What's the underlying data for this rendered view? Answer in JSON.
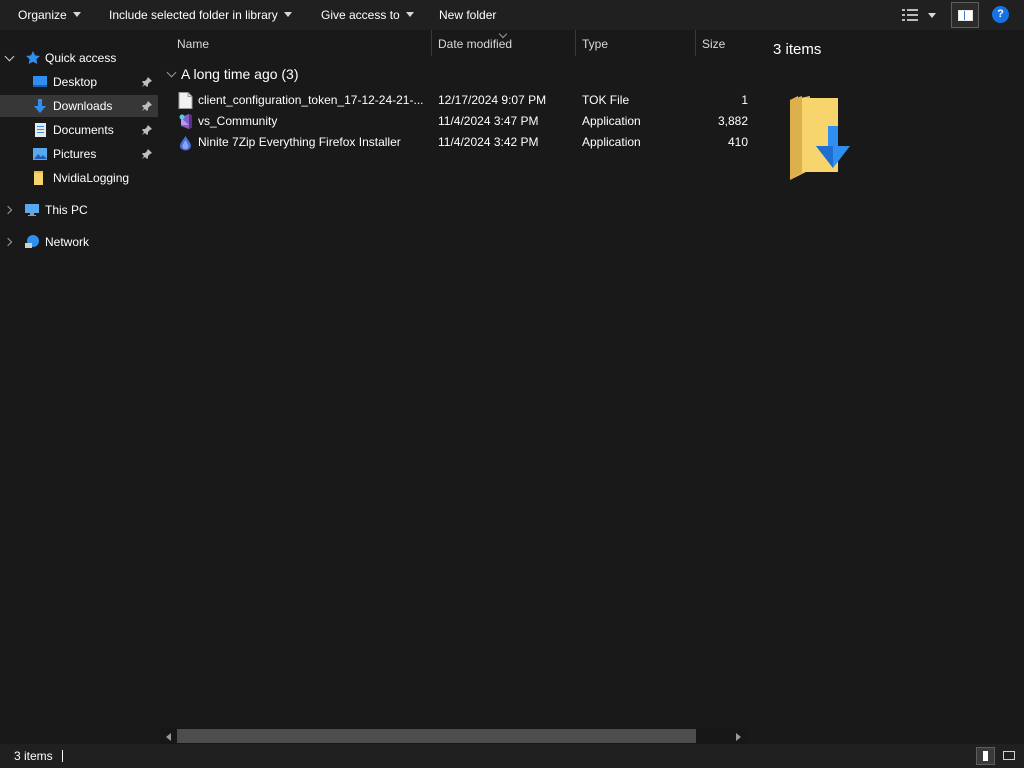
{
  "toolbar": {
    "organize": "Organize",
    "include_library": "Include selected folder in library",
    "give_access": "Give access to",
    "new_folder": "New folder"
  },
  "nav": {
    "quick_access": "Quick access",
    "items": [
      {
        "label": "Desktop",
        "icon": "desktop-icon",
        "pinned": true
      },
      {
        "label": "Downloads",
        "icon": "downloads-icon",
        "pinned": true,
        "selected": true
      },
      {
        "label": "Documents",
        "icon": "documents-icon",
        "pinned": true
      },
      {
        "label": "Pictures",
        "icon": "pictures-icon",
        "pinned": true
      },
      {
        "label": "NvidiaLogging",
        "icon": "folder-icon",
        "pinned": false
      }
    ],
    "this_pc": "This PC",
    "network": "Network"
  },
  "columns": {
    "name": "Name",
    "date": "Date modified",
    "type": "Type",
    "size": "Size"
  },
  "group": {
    "label": "A long time ago (3)"
  },
  "files": [
    {
      "name": "client_configuration_token_17-12-24-21-...",
      "date": "12/17/2024 9:07 PM",
      "type": "TOK File",
      "size": "1",
      "icon": "document-file-icon"
    },
    {
      "name": "vs_Community",
      "date": "11/4/2024 3:47 PM",
      "type": "Application",
      "size": "3,882",
      "icon": "visual-studio-icon"
    },
    {
      "name": "Ninite 7Zip Everything Firefox Installer",
      "date": "11/4/2024 3:42 PM",
      "type": "Application",
      "size": "410",
      "icon": "ninite-icon"
    }
  ],
  "preview": {
    "title": "3 items",
    "icon": "downloads-folder-icon"
  },
  "status": {
    "count": "3 items"
  },
  "colors": {
    "background": "#191919",
    "toolbar": "#202020",
    "selection": "#373737",
    "accent": "#1473e6"
  }
}
